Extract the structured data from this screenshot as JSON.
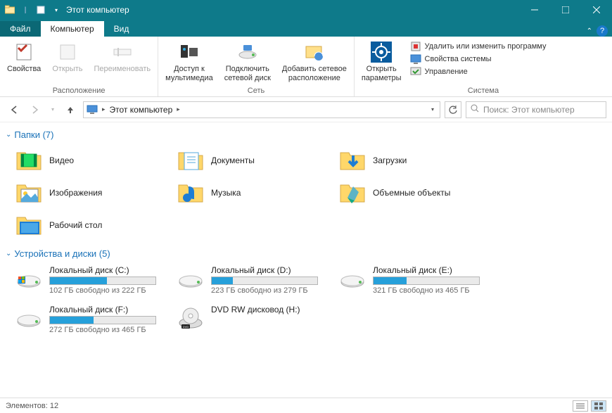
{
  "window": {
    "title": "Этот компьютер"
  },
  "tabs": {
    "file": "Файл",
    "computer": "Компьютер",
    "view": "Вид"
  },
  "ribbon": {
    "group1": {
      "label": "Расположение",
      "props": "Свойства",
      "open": "Открыть",
      "rename": "Переименовать"
    },
    "group2": {
      "label": "Сеть",
      "media": "Доступ к\nмультимедиа",
      "netdrive": "Подключить\nсетевой диск",
      "netloc": "Добавить сетевое\nрасположение"
    },
    "group3": {
      "label": "Система",
      "params": "Открыть\nпараметры",
      "uninstall": "Удалить или изменить программу",
      "sysprops": "Свойства системы",
      "manage": "Управление"
    }
  },
  "nav": {
    "crumb": "Этот компьютер",
    "search_placeholder": "Поиск: Этот компьютер"
  },
  "sections": {
    "folders": "Папки (7)",
    "drives": "Устройства и диски (5)"
  },
  "folders": [
    {
      "name": "Видео"
    },
    {
      "name": "Документы"
    },
    {
      "name": "Загрузки"
    },
    {
      "name": "Изображения"
    },
    {
      "name": "Музыка"
    },
    {
      "name": "Объемные объекты"
    },
    {
      "name": "Рабочий стол"
    }
  ],
  "drives": [
    {
      "name": "Локальный диск (C:)",
      "free": "102 ГБ свободно из 222 ГБ",
      "pct": 54
    },
    {
      "name": "Локальный диск (D:)",
      "free": "223 ГБ свободно из 279 ГБ",
      "pct": 20
    },
    {
      "name": "Локальный диск (E:)",
      "free": "321 ГБ свободно из 465 ГБ",
      "pct": 31
    },
    {
      "name": "Локальный диск (F:)",
      "free": "272 ГБ свободно из 465 ГБ",
      "pct": 41
    },
    {
      "name": "DVD RW дисковод (H:)",
      "free": "",
      "pct": -1
    }
  ],
  "status": {
    "count": "Элементов: 12"
  }
}
